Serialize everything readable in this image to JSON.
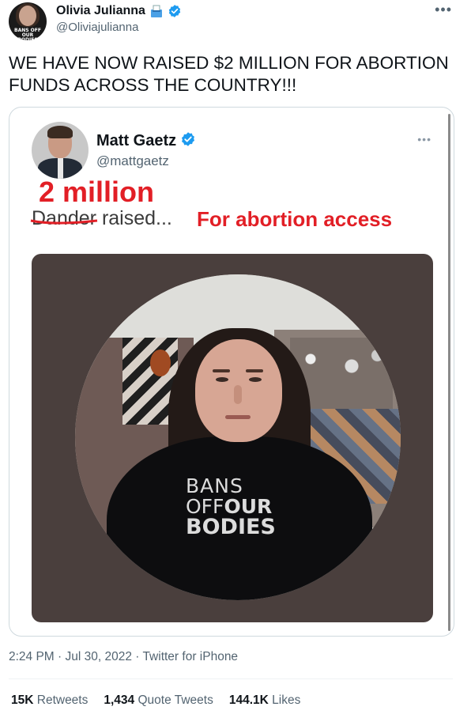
{
  "author": {
    "name": "Olivia Julianna",
    "handle": "@Oliviajulianna",
    "avatar_text": "BANS OFF OUR BODIES"
  },
  "tweet": {
    "text": "WE HAVE NOW RAISED $2 MILLION FOR ABORTION FUNDS ACROSS THE COUNTRY!!!"
  },
  "quoted": {
    "name": "Matt Gaetz",
    "handle": "@mattgaetz",
    "overlay_million": "2 million",
    "struck_word": "Dander",
    "raised_text": " raised...",
    "overlay_access": "For abortion access",
    "shirt_line1": "BANS",
    "shirt_line2_a": "OFF",
    "shirt_line2_b": "OUR",
    "shirt_line3": "BODIES"
  },
  "meta": {
    "time": "2:24 PM",
    "date": "Jul 30, 2022",
    "source": "Twitter for iPhone",
    "line": "2:24 PM · Jul 30, 2022 · Twitter for iPhone"
  },
  "stats": {
    "retweets_count": "15K",
    "retweets_label": "Retweets",
    "quotes_count": "1,434",
    "quotes_label": "Quote Tweets",
    "likes_count": "144.1K",
    "likes_label": "Likes"
  },
  "colors": {
    "verified": "#1d9bf0",
    "overlay_red": "#e21f26",
    "secondary_text": "#536471"
  },
  "icons": [
    "verified-badge-icon",
    "ballot-box-icon",
    "more-options-icon"
  ]
}
